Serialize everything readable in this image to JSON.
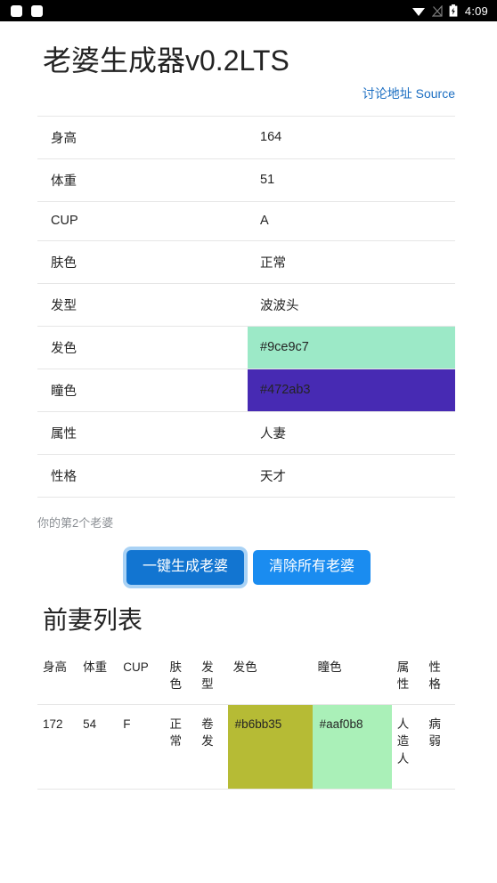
{
  "statusbar": {
    "time": "4:09",
    "icons": [
      "square-icon",
      "square-icon",
      "wifi-icon",
      "signal-off-icon",
      "battery-charging-icon"
    ]
  },
  "header": {
    "title": "老婆生成器v0.2LTS",
    "links": [
      {
        "label": "讨论地址",
        "color": "#1b6ec2"
      },
      {
        "label": "Source",
        "color": "#1b6ec2"
      }
    ]
  },
  "current_wife": {
    "rows": [
      {
        "key": "身高",
        "value": "164",
        "bg": ""
      },
      {
        "key": "体重",
        "value": "51",
        "bg": ""
      },
      {
        "key": "CUP",
        "value": "A",
        "bg": ""
      },
      {
        "key": "肤色",
        "value": "正常",
        "bg": ""
      },
      {
        "key": "发型",
        "value": "波波头",
        "bg": ""
      },
      {
        "key": "发色",
        "value": "#9ce9c7",
        "bg": "#9ce9c7"
      },
      {
        "key": "瞳色",
        "value": "#472ab3",
        "bg": "#472ab3"
      },
      {
        "key": "属性",
        "value": "人妻",
        "bg": ""
      },
      {
        "key": "性格",
        "value": "天才",
        "bg": ""
      }
    ],
    "note": "你的第2个老婆"
  },
  "actions": {
    "generate_label": "一键生成老婆",
    "clear_label": "清除所有老婆",
    "primary_color": "#1275d1",
    "secondary_color": "#1a8cf0",
    "focus_ring_color": "#a9d2f5"
  },
  "ex_wives": {
    "title": "前妻列表",
    "headers": [
      "身高",
      "体重",
      "CUP",
      "肤色",
      "发型",
      "发色",
      "瞳色",
      "属性",
      "性格"
    ],
    "rows": [
      {
        "height": "172",
        "weight": "54",
        "cup": "F",
        "skin": "正常",
        "hairstyle": "卷发",
        "haircolor": "#b6bb35",
        "haircolor_bg": "#b6bb35",
        "eyecolor": "#aaf0b8",
        "eyecolor_bg": "#aaf0b8",
        "attribute": "人造人",
        "personality": "病弱"
      }
    ]
  }
}
